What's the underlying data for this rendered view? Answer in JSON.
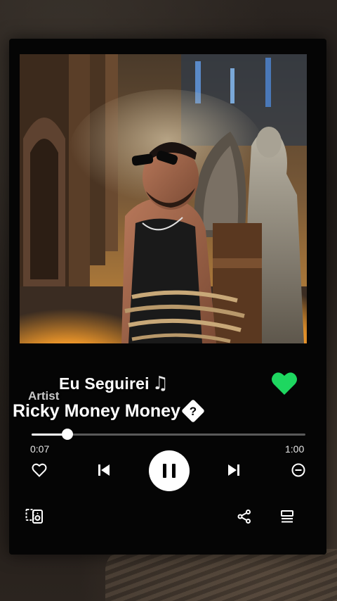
{
  "player": {
    "song_title": "Eu Seguirei",
    "artist_caption": "Artist",
    "artist_name": "Ricky Money Money",
    "elapsed": "0:07",
    "duration": "1:00",
    "progress_fraction": 0.13,
    "liked": true
  },
  "colors": {
    "liked_green": "#1ed760",
    "card_bg": "#050505",
    "track": "#5a5a5a"
  },
  "icons": {
    "title_note": "music-note-icon",
    "title_extra": "unknown-character-icon",
    "like": "heart-filled-icon",
    "add": "heart-outline-icon",
    "prev": "skip-previous-icon",
    "play_pause": "pause-icon",
    "next": "skip-next-icon",
    "hide": "minus-circle-icon",
    "devices": "connect-device-icon",
    "share": "share-icon",
    "queue": "queue-icon"
  }
}
